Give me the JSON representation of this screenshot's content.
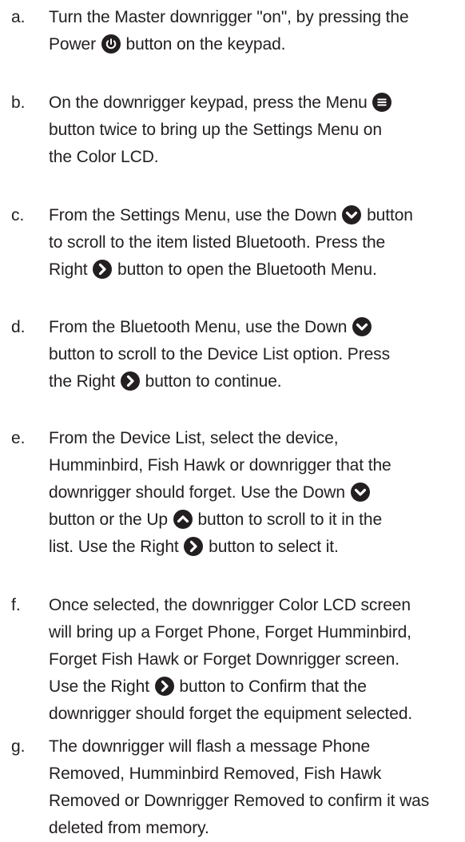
{
  "steps": [
    {
      "letter": "a.",
      "lines": [
        [
          {
            "t": "Turn the Master downrigger \"on\", by pressing the"
          }
        ],
        [
          {
            "t": "Power "
          },
          {
            "icon": "power-icon"
          },
          {
            "t": " button on the keypad."
          }
        ]
      ]
    },
    {
      "letter": "b.",
      "lines": [
        [
          {
            "t": "On the downrigger keypad, press the Menu "
          },
          {
            "icon": "menu-icon"
          }
        ],
        [
          {
            "t": "button twice to bring up the Settings Menu on"
          }
        ],
        [
          {
            "t": "the Color LCD."
          }
        ]
      ]
    },
    {
      "letter": "c.",
      "lines": [
        [
          {
            "t": "From the Settings Menu, use the Down "
          },
          {
            "icon": "chevron-down-icon"
          },
          {
            "t": " button"
          }
        ],
        [
          {
            "t": "to scroll to the item listed Bluetooth. Press the"
          }
        ],
        [
          {
            "t": "Right "
          },
          {
            "icon": "chevron-right-icon"
          },
          {
            "t": " button to open the Bluetooth Menu."
          }
        ]
      ]
    },
    {
      "letter": "d.",
      "lines": [
        [
          {
            "t": "From the Bluetooth Menu, use the Down "
          },
          {
            "icon": "chevron-down-icon"
          }
        ],
        [
          {
            "t": "button to scroll to the Device List option. Press"
          }
        ],
        [
          {
            "t": "the Right "
          },
          {
            "icon": "chevron-right-icon"
          },
          {
            "t": " button to continue."
          }
        ]
      ]
    },
    {
      "letter": "e.",
      "lines": [
        [
          {
            "t": "From the Device List, select the device,"
          }
        ],
        [
          {
            "t": "Humminbird, Fish Hawk or downrigger that the"
          }
        ],
        [
          {
            "t": "downrigger should forget. Use the Down "
          },
          {
            "icon": "chevron-down-icon"
          }
        ],
        [
          {
            "t": "button or the Up "
          },
          {
            "icon": "chevron-up-icon"
          },
          {
            "t": " button to scroll to it in the"
          }
        ],
        [
          {
            "t": "list. Use the Right "
          },
          {
            "icon": "chevron-right-icon"
          },
          {
            "t": " button to select it."
          }
        ]
      ]
    },
    {
      "letter": "f.",
      "lines": [
        [
          {
            "t": "Once selected, the downrigger Color LCD screen"
          }
        ],
        [
          {
            "t": "will bring up a Forget Phone, Forget Humminbird,"
          }
        ],
        [
          {
            "t": "Forget Fish Hawk or Forget Downrigger screen."
          }
        ],
        [
          {
            "t": "Use the Right "
          },
          {
            "icon": "chevron-right-icon"
          },
          {
            "t": " button to Confirm that the"
          }
        ],
        [
          {
            "t": "downrigger should forget the equipment selected."
          }
        ]
      ]
    },
    {
      "letter": "g.",
      "lines": [
        [
          {
            "t": "The downrigger will flash a message Phone"
          }
        ],
        [
          {
            "t": "Removed, Humminbird Removed, Fish Hawk"
          }
        ],
        [
          {
            "t": "Removed or Downrigger Removed to confirm it was"
          }
        ],
        [
          {
            "t": "deleted from memory."
          }
        ]
      ]
    }
  ]
}
